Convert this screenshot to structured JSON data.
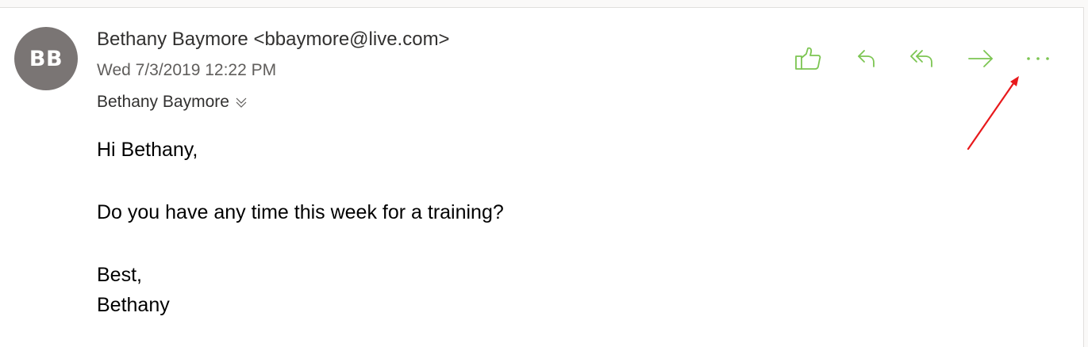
{
  "message": {
    "avatar_initials": "BB",
    "sender_line": "Bethany Baymore <bbaymore@live.com>",
    "date": "Wed 7/3/2019 12:22 PM",
    "recipient": "Bethany Baymore",
    "body": {
      "greeting": "Hi Bethany,",
      "text": "Do you have any time this week for a training?",
      "closing": "Best,",
      "signature": "Bethany"
    }
  },
  "toolbar": {
    "accent_color": "#7cc552",
    "actions": [
      "like-icon",
      "reply-icon",
      "reply-all-icon",
      "forward-icon",
      "more-actions-icon"
    ]
  },
  "annotation": {
    "arrow_color": "#e8191c"
  }
}
